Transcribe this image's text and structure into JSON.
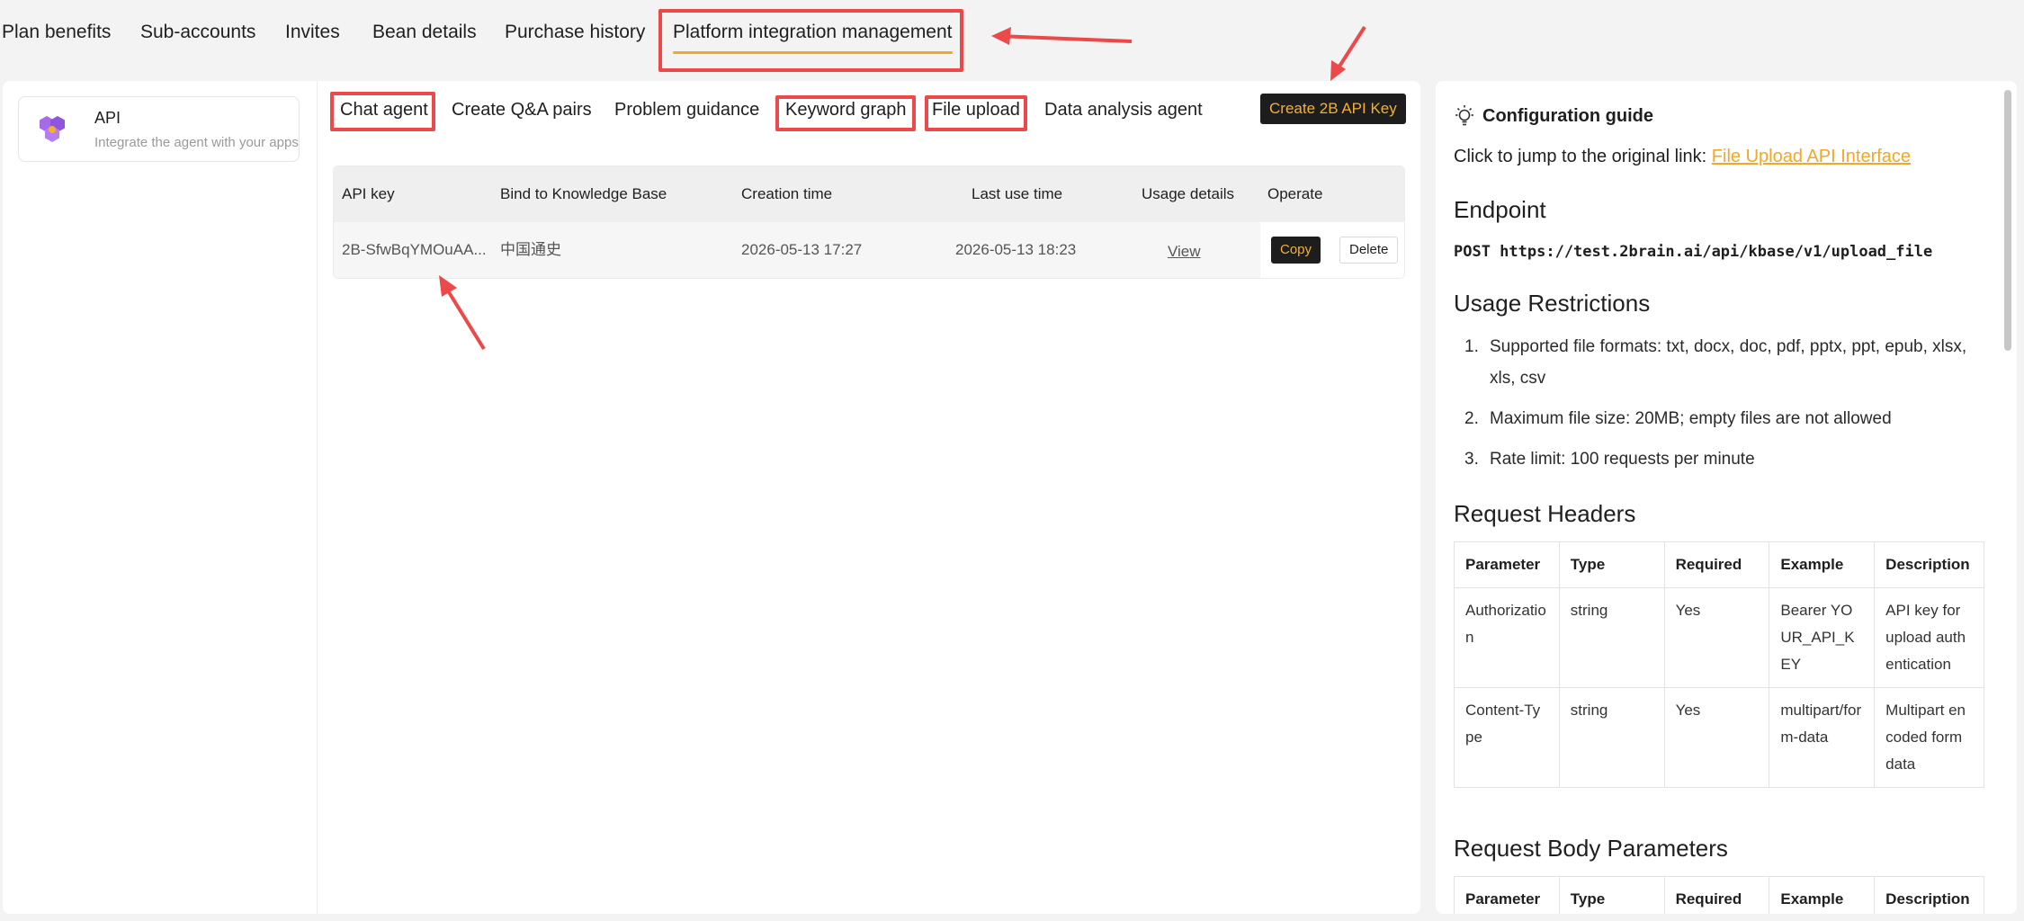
{
  "top_tabs": [
    "Plan benefits",
    "Sub-accounts",
    "Invites",
    "Bean details",
    "Purchase history",
    "Platform integration management"
  ],
  "sidebar": {
    "api_card": {
      "title": "API",
      "subtitle": "Integrate the agent with your apps"
    }
  },
  "sub_tabs": [
    "Chat agent",
    "Create Q&A pairs",
    "Problem guidance",
    "Keyword graph",
    "File upload",
    "Data analysis agent"
  ],
  "create_button": "Create 2B API Key",
  "key_table": {
    "headers": [
      "API key",
      "Bind to Knowledge Base",
      "Creation time",
      "Last use time",
      "Usage details",
      "Operate"
    ],
    "rows": [
      {
        "api_key": "2B-SfwBqYMOuAA...",
        "knowledge_base": "中国通史",
        "creation_time": "2026-05-13 17:27",
        "last_use_time": "2026-05-13 18:23",
        "usage_details": "View",
        "copy": "Copy",
        "delete": "Delete"
      }
    ]
  },
  "guide": {
    "title": "Configuration guide",
    "link_prefix": "Click to jump to the original link: ",
    "link_text": "File Upload API Interface",
    "endpoint_heading": "Endpoint",
    "endpoint": "POST https://test.2brain.ai/api/kbase/v1/upload_file",
    "restrictions_heading": "Usage Restrictions",
    "restrictions": [
      "Supported file formats: txt, docx, doc, pdf, pptx, ppt, epub, xlsx, xls, csv",
      "Maximum file size: 20MB; empty files are not allowed",
      "Rate limit: 100 requests per minute"
    ],
    "headers_heading": "Request Headers",
    "headers_table": {
      "columns": [
        "Parameter",
        "Type",
        "Required",
        "Example",
        "Description"
      ],
      "rows": [
        [
          "Authorization",
          "string",
          "Yes",
          "Bearer YOUR_API_KEY",
          "API key for upload authentication"
        ],
        [
          "Content-Type",
          "string",
          "Yes",
          "multipart/form-data",
          "Multipart encoded form data"
        ]
      ]
    },
    "body_heading": "Request Body Parameters",
    "body_table": {
      "columns": [
        "Parameter",
        "Type",
        "Required",
        "Example",
        "Description"
      ]
    }
  },
  "colors": {
    "accent": "#f5a623",
    "annotation": "#ec4a4a",
    "dark_button": "#1d1d1d"
  }
}
